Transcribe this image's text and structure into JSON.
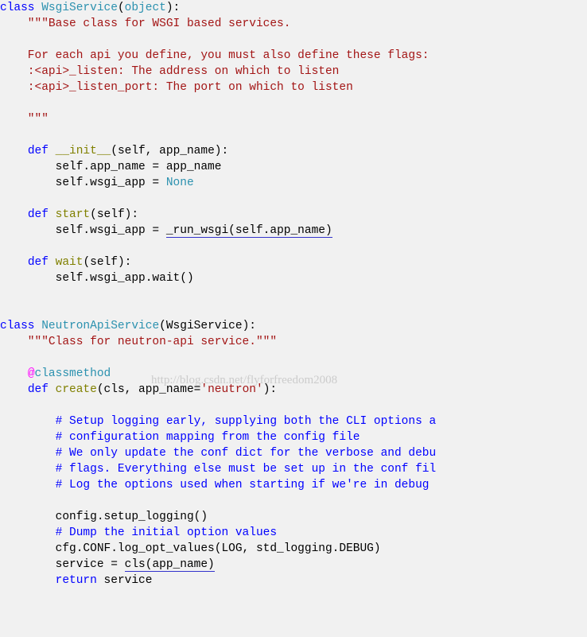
{
  "line1_class": "class",
  "line1_name": " WsgiService",
  "line1_paren_open": "(",
  "line1_object": "object",
  "line1_paren_close": "):",
  "line2": "    \"\"\"Base class for WSGI based services.",
  "blank": "",
  "line4": "    For each api you define, you must also define these flags:",
  "line5": "    :<api>_listen: The address on which to listen",
  "line6": "    :<api>_listen_port: The port on which to listen",
  "line8": "    \"\"\"",
  "line10_indent": "    ",
  "line10_def": "def",
  "line10_space": " ",
  "line10_name": "__init__",
  "line10_rest": "(self, app_name):",
  "line11": "        self.app_name = app_name",
  "line12_a": "        self.wsgi_app = ",
  "line12_b": "None",
  "line14_indent": "    ",
  "line14_def": "def",
  "line14_space": " ",
  "line14_name": "start",
  "line14_rest": "(self):",
  "line15_a": "        self.wsgi_app = ",
  "line15_b": "_run_wsgi(self.app_name)",
  "line17_indent": "    ",
  "line17_def": "def",
  "line17_space": " ",
  "line17_name": "wait",
  "line17_rest": "(self):",
  "line18": "        self.wsgi_app.wait()",
  "line21_class": "class",
  "line21_name": " NeutronApiService",
  "line21_rest": "(WsgiService):",
  "line22": "    \"\"\"Class for neutron-api service.\"\"\"",
  "line24_indent": "    ",
  "line24_at": "@",
  "line24_dec": "classmethod",
  "line25_indent": "    ",
  "line25_def": "def",
  "line25_space": " ",
  "line25_name": "create",
  "line25_a": "(cls, app_name=",
  "line25_b": "'neutron'",
  "line25_c": "):",
  "line27": "        # Setup logging early, supplying both the CLI options a",
  "line28": "        # configuration mapping from the config file",
  "line29": "        # We only update the conf dict for the verbose and debu",
  "line30": "        # flags. Everything else must be set up in the conf fil",
  "line31": "        # Log the options used when starting if we're in debug ",
  "line33": "        config.setup_logging()",
  "line34": "        # Dump the initial option values",
  "line35": "        cfg.CONF.log_opt_values(LOG, std_logging.DEBUG)",
  "line36_a": "        service = ",
  "line36_b": "cls(app_name)",
  "line37_a": "        ",
  "line37_b": "return",
  "line37_c": " service",
  "watermark": "http://blog.csdn.net/flyforfreedom2008"
}
